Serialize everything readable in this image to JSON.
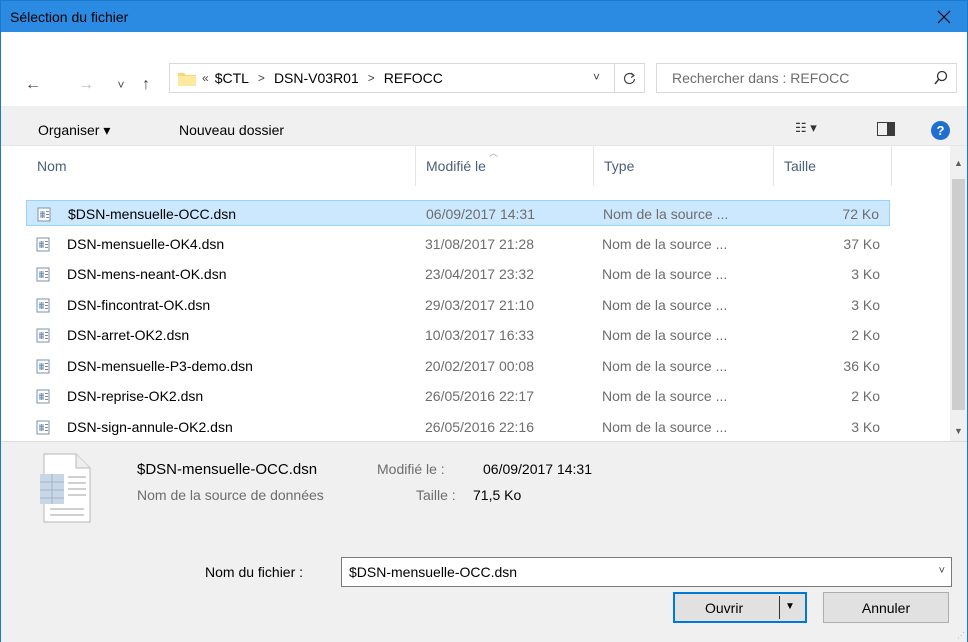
{
  "window": {
    "title": "Sélection du fichier"
  },
  "nav": {
    "back_label": "←",
    "forward_label": "→",
    "recent_label": "˅",
    "up_label": "↑",
    "overflow": "«",
    "breadcrumbs": [
      "$CTL",
      "DSN-V03R01",
      "REFOCC"
    ],
    "search_placeholder": "Rechercher dans : REFOCC"
  },
  "commands": {
    "organize": "Organiser ▾",
    "new_folder": "Nouveau dossier"
  },
  "columns": {
    "name": "Nom",
    "modified": "Modifié le",
    "type": "Type",
    "size": "Taille"
  },
  "files": [
    {
      "name": "$DSN-mensuelle-OCC.dsn",
      "modified": "06/09/2017 14:31",
      "type": "Nom de la source ...",
      "size": "72 Ko",
      "selected": true
    },
    {
      "name": "DSN-mensuelle-OK4.dsn",
      "modified": "31/08/2017 21:28",
      "type": "Nom de la source ...",
      "size": "37 Ko"
    },
    {
      "name": "DSN-mens-neant-OK.dsn",
      "modified": "23/04/2017 23:32",
      "type": "Nom de la source ...",
      "size": "3 Ko"
    },
    {
      "name": "DSN-fincontrat-OK.dsn",
      "modified": "29/03/2017 21:10",
      "type": "Nom de la source ...",
      "size": "3 Ko"
    },
    {
      "name": "DSN-arret-OK2.dsn",
      "modified": "10/03/2017 16:33",
      "type": "Nom de la source ...",
      "size": "2 Ko"
    },
    {
      "name": "DSN-mensuelle-P3-demo.dsn",
      "modified": "20/02/2017 00:08",
      "type": "Nom de la source ...",
      "size": "36 Ko"
    },
    {
      "name": "DSN-reprise-OK2.dsn",
      "modified": "26/05/2016 22:17",
      "type": "Nom de la source ...",
      "size": "2 Ko"
    },
    {
      "name": "DSN-sign-annule-OK2.dsn",
      "modified": "26/05/2016 22:16",
      "type": "Nom de la source ...",
      "size": "3 Ko"
    }
  ],
  "details": {
    "name": "$DSN-mensuelle-OCC.dsn",
    "type": "Nom de la source de données",
    "modified_label": "Modifié le :",
    "modified_value": "06/09/2017 14:31",
    "size_label": "Taille :",
    "size_value": "71,5 Ko"
  },
  "footer": {
    "filename_label": "Nom du fichier :",
    "filename_value": "$DSN-mensuelle-OCC.dsn",
    "open_label": "Ouvrir",
    "cancel_label": "Annuler"
  },
  "colors": {
    "titlebar": "#2b8ae2",
    "selection": "#cce8ff",
    "accent": "#0078d7"
  }
}
